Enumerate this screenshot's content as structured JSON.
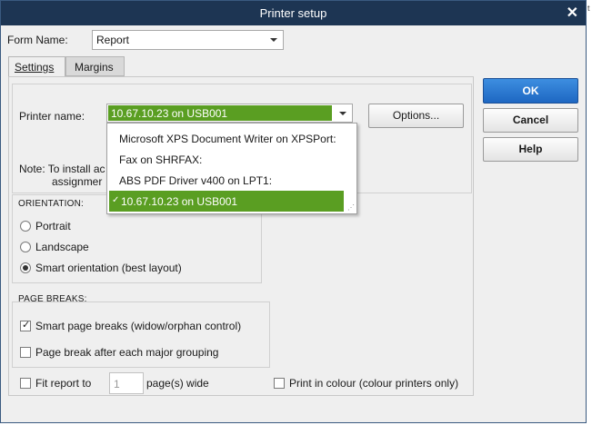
{
  "window": {
    "title": "Printer setup",
    "close_symbol": "✕"
  },
  "form_name": {
    "label": "Form Name:",
    "value": "Report"
  },
  "tabs": [
    {
      "label": "Settings"
    },
    {
      "label": "Margins"
    }
  ],
  "printer": {
    "label": "Printer name:",
    "value": "10.67.10.23 on USB001",
    "options_label": "Options...",
    "selected_color": "#5a9e22"
  },
  "dropdown": {
    "items": [
      {
        "label": "Microsoft XPS Document Writer on XPSPort:"
      },
      {
        "label": "Fax on SHRFAX:"
      },
      {
        "label": "ABS PDF Driver v400 on LPT1:"
      },
      {
        "label": "10.67.10.23 on USB001",
        "selected": true
      }
    ],
    "check_mark": "✓"
  },
  "note": {
    "line1": "Note: To install ac",
    "line2": "assignmer"
  },
  "orientation": {
    "heading": "ORIENTATION:",
    "options": [
      {
        "label": "Portrait",
        "checked": false
      },
      {
        "label": "Landscape",
        "checked": false
      },
      {
        "label": "Smart orientation (best layout)",
        "checked": true
      }
    ]
  },
  "page_breaks": {
    "heading": "PAGE BREAKS:",
    "options": [
      {
        "label": "Smart page breaks (widow/orphan control)",
        "checked": true
      },
      {
        "label": "Page break after each major grouping",
        "checked": false
      }
    ]
  },
  "fit_report": {
    "label": "Fit report to",
    "value": "1",
    "suffix": "page(s) wide",
    "checked": false
  },
  "print_colour": {
    "label": "Print in colour (colour printers only)",
    "checked": false
  },
  "buttons": {
    "ok": "OK",
    "cancel": "Cancel",
    "help": "Help"
  },
  "colors": {
    "titlebar": "#1d3553",
    "ok_button": "#2a78d2",
    "dialog_bg": "#efefef"
  },
  "check_glyph": "✓"
}
